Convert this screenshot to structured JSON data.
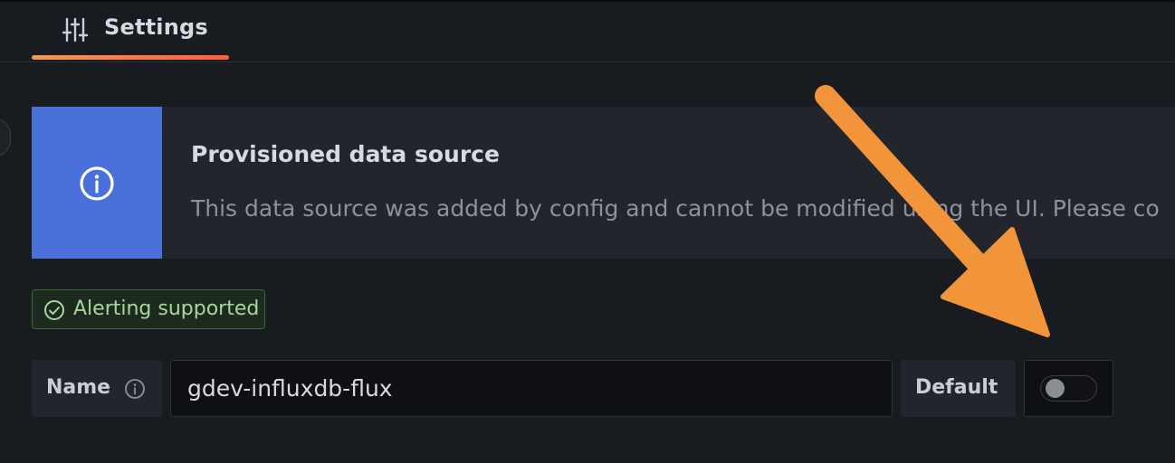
{
  "tabs": [
    {
      "label": "Settings",
      "icon": "sliders-icon",
      "active": true
    }
  ],
  "alert": {
    "title": "Provisioned data source",
    "message": "This data source was added by config and cannot be modified using the UI. Please co",
    "icon": "info-circle-icon",
    "color": "#4a71d9"
  },
  "badge": {
    "label": "Alerting supported",
    "icon": "check-circle-icon"
  },
  "form": {
    "name_label": "Name",
    "name_value": "gdev-influxdb-flux",
    "default_label": "Default",
    "default_on": false
  },
  "annotation": {
    "icon": "arrow-annotation",
    "color": "#f2943a"
  }
}
